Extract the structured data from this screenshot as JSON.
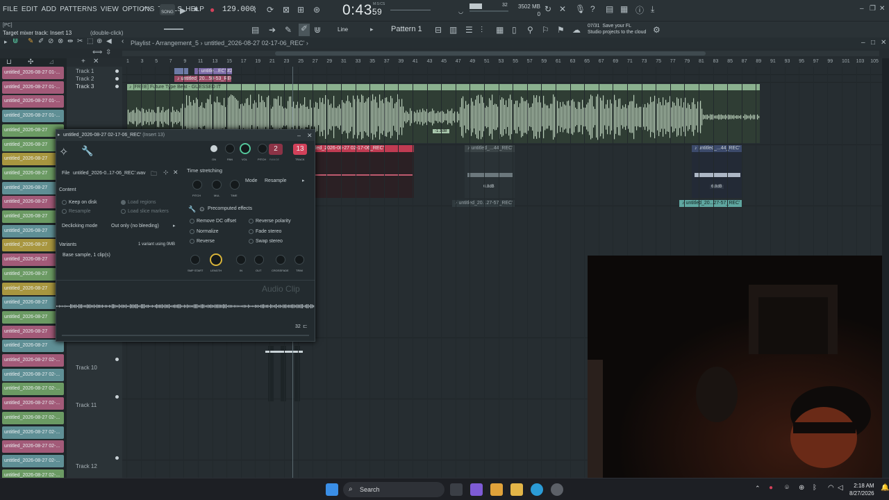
{
  "menu": [
    "FILE",
    "EDIT",
    "ADD",
    "PATTERNS",
    "VIEW",
    "OPTIONS",
    "TOOLS",
    "HELP"
  ],
  "transport": {
    "song_mode_label": "SONG",
    "tempo": "129.000",
    "time_main": "0:43",
    "time_sub": "59",
    "time_unit": "M:S:CS"
  },
  "system": {
    "cpu_top": "32",
    "ram": "3502 MB",
    "polyphony": "0"
  },
  "hint": {
    "pc_tag": "[PC]",
    "target": "Target mixer track: Insert 13",
    "action": "(double-click)"
  },
  "toolbar": {
    "snap_label": "Line",
    "pattern_label": "Pattern 1"
  },
  "news": {
    "counter": "07/31",
    "line1": "Save your FL",
    "line2": "Studio projects to the cloud"
  },
  "playlist": {
    "title": "Playlist - Arrangement_5",
    "breadcrumb_sep": "›",
    "clip_name": "untitled_2026-08-27 02-17-06_REC'",
    "ruler": [
      "1",
      "3",
      "5",
      "7",
      "9",
      "11",
      "13",
      "15",
      "17",
      "19",
      "21",
      "23",
      "25",
      "27",
      "29",
      "31",
      "33",
      "35",
      "37",
      "39",
      "41",
      "43",
      "45",
      "47",
      "49",
      "51",
      "53",
      "55",
      "57",
      "59",
      "61",
      "63",
      "65",
      "67",
      "69",
      "71",
      "73",
      "75",
      "77",
      "79",
      "81",
      "83",
      "85",
      "87",
      "89",
      "91",
      "93",
      "95",
      "97",
      "99",
      "101",
      "103",
      "105"
    ],
    "tracks": {
      "t1": "Track 1",
      "t2": "Track 2",
      "t3": "Track 3",
      "t10": "Track 10",
      "t11": "Track 11",
      "t12": "Track 12"
    },
    "clips": {
      "t3_title": "♪ [FREE] Future Type Beat - GUESSED IT",
      "t1a": "♪ untitle...EC' #2",
      "t2a": "♪ untitled_20...50-53_REC",
      "t4_main": "tled_2026-08-27 02-17-06_REC'",
      "t4_right1": "♪ untitled_...44_REC'",
      "t4_right2": "♪ untitled_...44_REC'",
      "t5_left": "♪ untitled_20...27-57_REC'",
      "t5_right": "♪ untitled_20...27-57_REC'",
      "db1": "-1.1dB",
      "db2": "6.8dB",
      "db3": "6.8dB"
    }
  },
  "sidebar_clips": [
    {
      "label": "untitled_2026-08-27 01-...",
      "color": "#a25a78"
    },
    {
      "label": "untitled_2026-08-27 01-...",
      "color": "#a25a78"
    },
    {
      "label": "untitled_2026-08-27 01-...",
      "color": "#a25a78"
    },
    {
      "label": "untitled_2026-08-27 01-...",
      "color": "#5f8f95"
    },
    {
      "label": "untitled_2026-08-27",
      "color": "#6b9a63"
    },
    {
      "label": "untitled_2026-08-27",
      "color": "#6b9a63"
    },
    {
      "label": "untitled_2026-08-27",
      "color": "#a8963f"
    },
    {
      "label": "untitled_2026-08-27",
      "color": "#6b9a63"
    },
    {
      "label": "untitled_2026-08-27",
      "color": "#5f8f95"
    },
    {
      "label": "untitled_2026-08-27",
      "color": "#a25a78"
    },
    {
      "label": "untitled_2026-08-27",
      "color": "#6b9a63"
    },
    {
      "label": "untitled_2026-08-27",
      "color": "#5f8f95"
    },
    {
      "label": "untitled_2026-08-27",
      "color": "#a8963f"
    },
    {
      "label": "untitled_2026-08-27",
      "color": "#a25a78"
    },
    {
      "label": "untitled_2026-08-27",
      "color": "#6b9a63"
    },
    {
      "label": "untitled_2026-08-27",
      "color": "#a8963f"
    },
    {
      "label": "untitled_2026-08-27",
      "color": "#5f8f95"
    },
    {
      "label": "untitled_2026-08-27",
      "color": "#6b9a63"
    },
    {
      "label": "untitled_2026-08-27",
      "color": "#a25a78"
    },
    {
      "label": "untitled_2026-08-27",
      "color": "#5f8f95"
    },
    {
      "label": "untitled_2026-08-27 02-...",
      "color": "#a25a78"
    },
    {
      "label": "untitled_2026-08-27 02-...",
      "color": "#5f8f95"
    },
    {
      "label": "untitled_2026-08-27 02-...",
      "color": "#6b9a63"
    },
    {
      "label": "untitled_2026-08-27 02-...",
      "color": "#a25a78"
    },
    {
      "label": "untitled_2026-08-27 02-...",
      "color": "#6b9a63"
    },
    {
      "label": "untitled_2026-08-27 02-...",
      "color": "#5f8f95"
    },
    {
      "label": "untitled_2026-08-27 02-...",
      "color": "#a25a78"
    },
    {
      "label": "untitled_2026-08-27 02-...",
      "color": "#5f8f95"
    },
    {
      "label": "untitled_2026-08-27 02-...",
      "color": "#6b9a63"
    },
    {
      "label": "untitled_2026-08-27 02-...",
      "color": "#a25a78"
    }
  ],
  "clipwin": {
    "title": "untitled_2026-08-27 02-17-06_REC'",
    "title_sub": "(Insert 13)",
    "file_label": "File",
    "file_value": "untitled_2026-0..17-06_REC'.wav",
    "time_stretching": "Time stretching",
    "mode_label": "Mode",
    "mode_value": "Resample",
    "content": "Content",
    "keep_on_disk": "Keep on disk",
    "resample": "Resample",
    "load_regions": "Load regions",
    "load_slice_markers": "Load slice markers",
    "declicking_label": "Declicking mode",
    "declicking_value": "Out only (no bleeding)",
    "precomputed": "Precomputed effects",
    "remove_dc": "Remove DC offset",
    "normalize": "Normalize",
    "reverse": "Reverse",
    "reverse_polarity": "Reverse polarity",
    "fade_stereo": "Fade stereo",
    "swap_stereo": "Swap stereo",
    "variants": "Variants",
    "variant_info": "1 variant using 0MB",
    "base_sample": "Base sample, 1 clip(s)",
    "knob_on": "ON",
    "knob_pan": "PAN",
    "knob_vol": "VOL",
    "knob_pitch": "PITCH",
    "knob_range": "RANGE",
    "knob_track": "TRACK",
    "range_value": "2",
    "track_value": "13",
    "ts_pitch": "PITCH",
    "ts_mul": "MUL",
    "ts_time": "TIME",
    "k_smp_start": "SMP START",
    "k_length": "LENGTH",
    "k_in": "IN",
    "k_out": "OUT",
    "k_crossfade": "CROSSFADE",
    "k_trim": "TRIM",
    "audio_clip": "Audio Clip",
    "zoom_value": "32"
  },
  "taskbar": {
    "search": "Search",
    "time": "2:18 AM",
    "date": "8/27/2026"
  },
  "colors": {
    "accent_red": "#d2415a",
    "track3_clip": "#8bb18f",
    "knob_yellow": "#d8b43a",
    "knob_green": "#54c79b"
  }
}
